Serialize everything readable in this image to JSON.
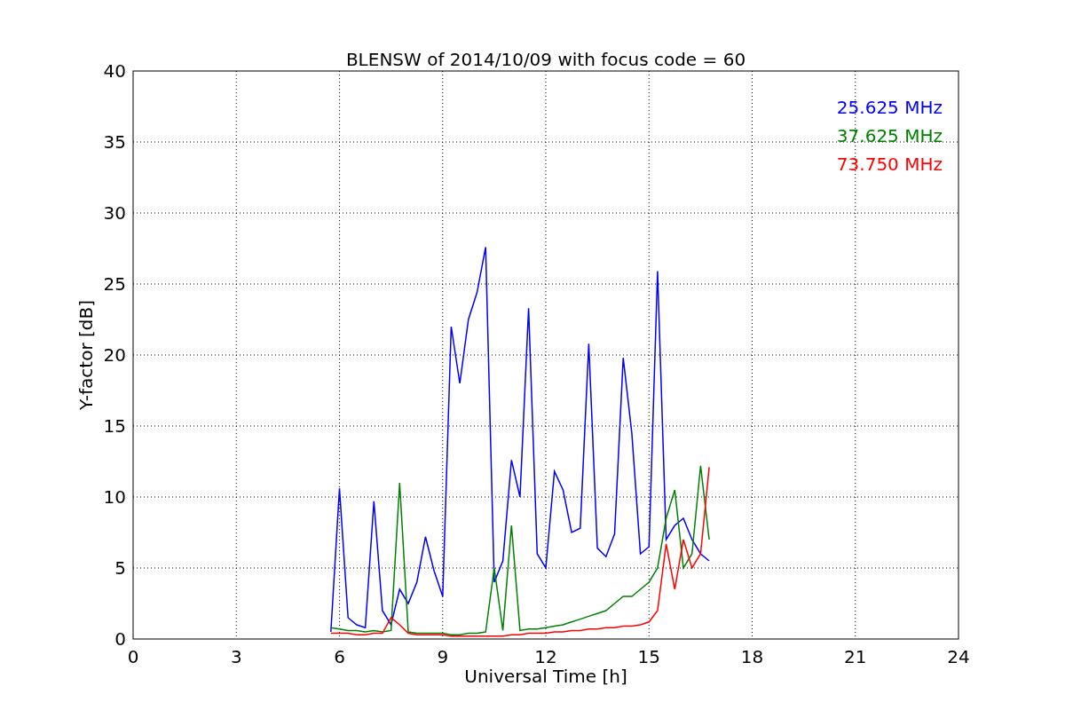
{
  "chart_data": {
    "type": "line",
    "title": "BLENSW of 2014/10/09 with focus code = 60",
    "xlabel": "Universal Time [h]",
    "ylabel": "Y-factor [dB]",
    "x": [
      5.75,
      6.0,
      6.25,
      6.5,
      6.75,
      7.0,
      7.25,
      7.5,
      7.75,
      8.0,
      8.25,
      8.5,
      8.75,
      9.0,
      9.25,
      9.5,
      9.75,
      10.0,
      10.25,
      10.5,
      10.75,
      11.0,
      11.25,
      11.5,
      11.75,
      12.0,
      12.25,
      12.5,
      12.75,
      13.0,
      13.25,
      13.5,
      13.75,
      14.0,
      14.25,
      14.5,
      14.75,
      15.0,
      15.25,
      15.5,
      15.75,
      16.0,
      16.25,
      16.5,
      16.75
    ],
    "series": [
      {
        "name": "25.625 MHz",
        "color": "#0000ff",
        "values": [
          0.5,
          10.6,
          1.5,
          1.0,
          0.8,
          9.7,
          2.0,
          1.0,
          3.5,
          2.5,
          4.0,
          7.2,
          4.8,
          3.0,
          22.0,
          18.0,
          22.5,
          24.4,
          27.6,
          4.0,
          5.5,
          12.6,
          10.0,
          23.3,
          6.0,
          5.0,
          11.8,
          10.5,
          7.5,
          7.8,
          20.8,
          6.4,
          5.8,
          7.4,
          19.8,
          14.5,
          6.0,
          6.5,
          25.9,
          7.0,
          8.0,
          8.5,
          7.0,
          6.0,
          5.5
        ]
      },
      {
        "name": "37.625 MHz",
        "color": "#008000",
        "values": [
          0.8,
          0.7,
          0.6,
          0.6,
          0.5,
          0.6,
          0.5,
          0.6,
          11.0,
          0.5,
          0.4,
          0.4,
          0.4,
          0.4,
          0.3,
          0.3,
          0.4,
          0.4,
          0.5,
          5.0,
          0.6,
          8.0,
          0.6,
          0.7,
          0.7,
          0.8,
          0.9,
          1.0,
          1.2,
          1.4,
          1.6,
          1.8,
          2.0,
          2.5,
          3.0,
          3.0,
          3.5,
          4.0,
          5.0,
          8.5,
          10.5,
          5.0,
          6.0,
          12.2,
          7.0
        ]
      },
      {
        "name": "73.750 MHz",
        "color": "#ff0000",
        "values": [
          0.4,
          0.4,
          0.4,
          0.3,
          0.3,
          0.4,
          0.4,
          1.5,
          1.0,
          0.4,
          0.3,
          0.3,
          0.3,
          0.3,
          0.2,
          0.2,
          0.2,
          0.2,
          0.2,
          0.2,
          0.2,
          0.3,
          0.3,
          0.4,
          0.4,
          0.4,
          0.5,
          0.5,
          0.6,
          0.6,
          0.7,
          0.7,
          0.8,
          0.8,
          0.9,
          0.9,
          1.0,
          1.2,
          2.0,
          6.7,
          3.5,
          7.0,
          5.0,
          6.0,
          12.1
        ]
      }
    ],
    "xlim": [
      0,
      24
    ],
    "ylim": [
      0,
      40
    ],
    "xticks": [
      0,
      3,
      6,
      9,
      12,
      15,
      18,
      21,
      24
    ],
    "yticks": [
      0,
      5,
      10,
      15,
      20,
      25,
      30,
      35,
      40
    ],
    "grid": true
  }
}
